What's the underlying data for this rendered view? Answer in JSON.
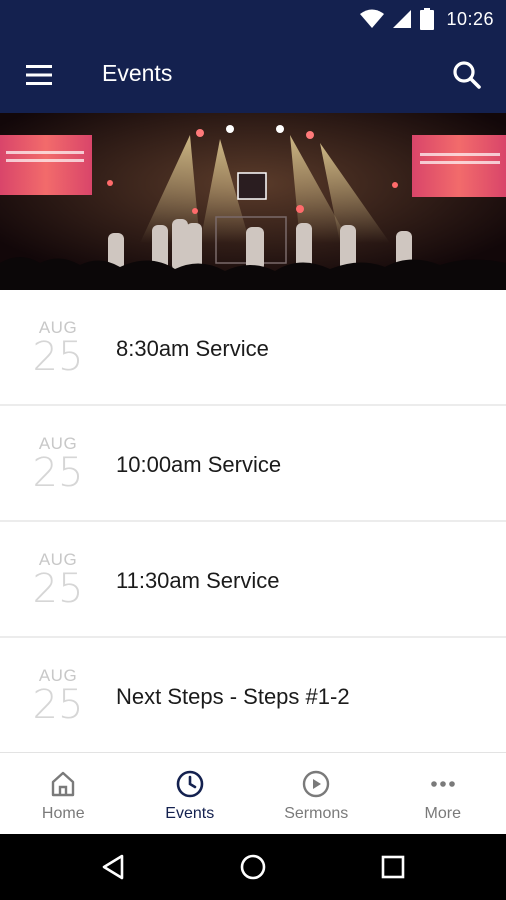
{
  "status_bar": {
    "time": "10:26"
  },
  "app_bar": {
    "title": "Events"
  },
  "events": [
    {
      "month": "AUG",
      "day": "25",
      "title": "8:30am Service"
    },
    {
      "month": "AUG",
      "day": "25",
      "title": "10:00am Service"
    },
    {
      "month": "AUG",
      "day": "25",
      "title": "11:30am Service"
    },
    {
      "month": "AUG",
      "day": "25",
      "title": "Next Steps - Steps #1-2"
    }
  ],
  "bottom_nav": {
    "items": [
      {
        "label": "Home",
        "icon": "home-icon",
        "active": false
      },
      {
        "label": "Events",
        "icon": "clock-icon",
        "active": true
      },
      {
        "label": "Sermons",
        "icon": "play-circle-icon",
        "active": false
      },
      {
        "label": "More",
        "icon": "more-dots-icon",
        "active": false
      }
    ]
  },
  "colors": {
    "primary": "#14214f",
    "inactive": "#7a7a7a",
    "date_gray": "#d0d0d0"
  }
}
